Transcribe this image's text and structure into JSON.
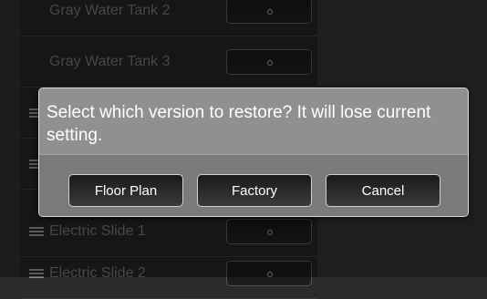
{
  "list": {
    "items": [
      {
        "label": "Gray Water Tank 2"
      },
      {
        "label": "Gray Water Tank 3"
      },
      {
        "label": ""
      },
      {
        "label": ""
      },
      {
        "label": "Electric Slide 1"
      },
      {
        "label": "Electric Slide 2"
      }
    ]
  },
  "dialog": {
    "message": "Select which version to restore? It will lose current setting.",
    "buttons": {
      "floor_plan": "Floor Plan",
      "factory": "Factory",
      "cancel": "Cancel"
    }
  },
  "icons": {
    "drag_handle": "drag-handle-icon",
    "toggle_indicator": "toggle-indicator-icon"
  }
}
